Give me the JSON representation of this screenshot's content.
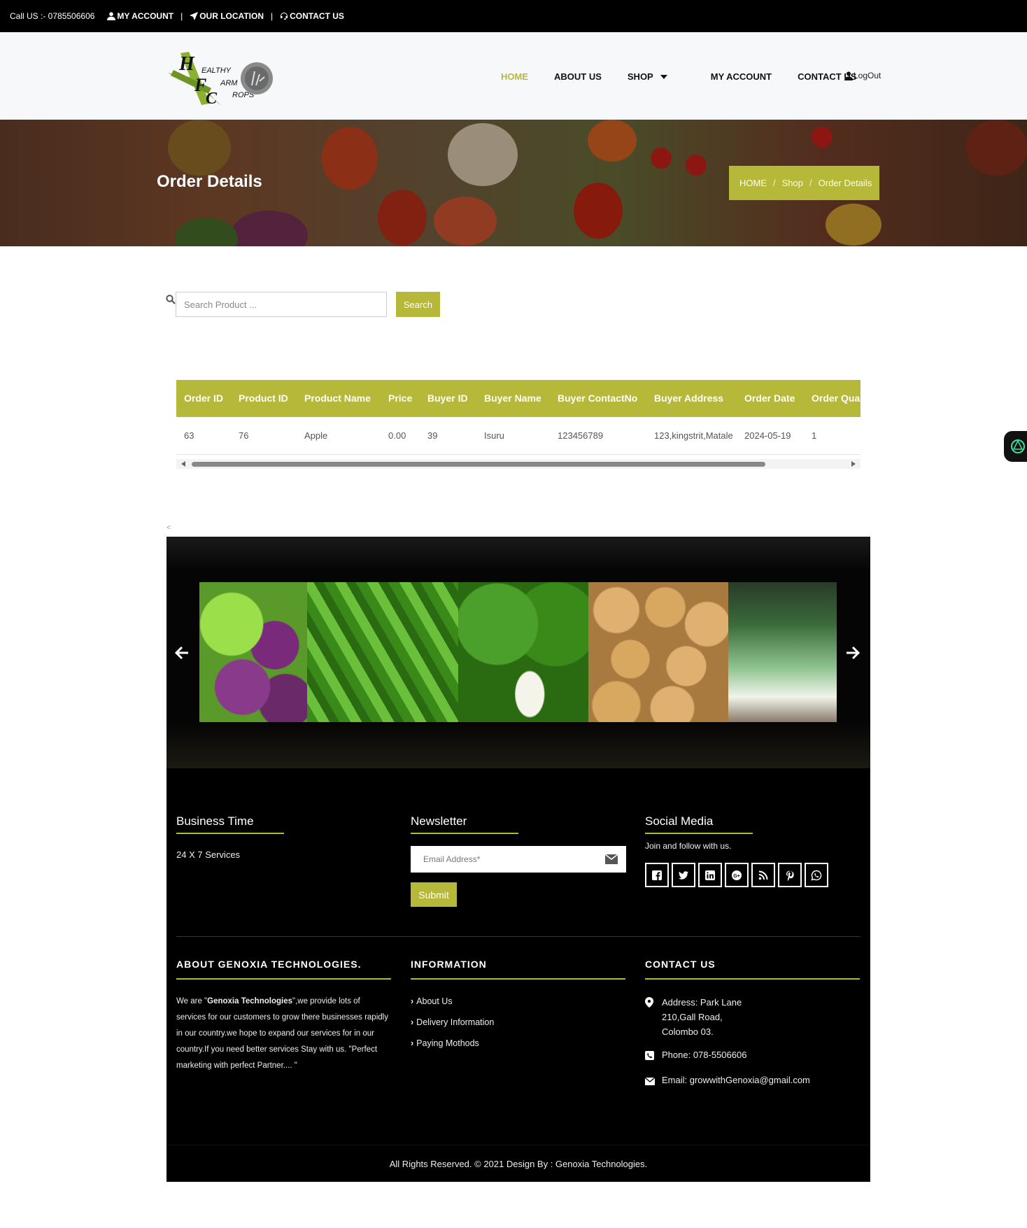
{
  "topbar": {
    "call_us": "Call US :- 0785506606",
    "my_account": "MY ACCOUNT",
    "our_location": "OUR LOCATION",
    "contact_us": "CONTACT US"
  },
  "logo": {
    "line1": "EALTHY",
    "line2": "ARM",
    "line3": "ROPS"
  },
  "nav": {
    "items": [
      {
        "label": "HOME",
        "active": true
      },
      {
        "label": "ABOUT US"
      },
      {
        "label": "SHOP"
      },
      {
        "label": "MY ACCOUNT"
      },
      {
        "label": "CONTACT US"
      }
    ],
    "logout": "LogOut"
  },
  "banner": {
    "title": "Order Details",
    "breadcrumb": [
      "HOME",
      "Shop",
      "Order Details"
    ]
  },
  "search": {
    "placeholder": "Search Product ...",
    "button": "Search"
  },
  "table": {
    "headers": [
      "Order ID",
      "Product ID",
      "Product Name",
      "Price",
      "Buyer ID",
      "Buyer Name",
      "Buyer ContactNo",
      "Buyer Address",
      "Order Date",
      "Order Qua"
    ],
    "rows": [
      [
        "63",
        "76",
        "Apple",
        "0.00",
        "39",
        "Isuru",
        "123456789",
        "123,kingstrit,Matale",
        "2024-05-19",
        "1"
      ]
    ]
  },
  "misc": {
    "lt_mark": "<"
  },
  "footer": {
    "business_title": "Business Time",
    "business_text": "24 X 7 Services",
    "newsletter_title": "Newsletter",
    "email_placeholder": "Email Address*",
    "submit": "Submit",
    "social_title": "Social Media",
    "social_text": "Join and follow with us.",
    "social_icons": [
      "facebook-icon",
      "twitter-icon",
      "linkedin-icon",
      "google-plus-icon",
      "rss-icon",
      "pinterest-icon",
      "whatsapp-icon"
    ],
    "about_title": "ABOUT GENOXIA TECHNOLOGIES.",
    "about_pre": "We are \"",
    "about_company": "Genoxia Technologies",
    "about_post": "\",we provide lots of services for our customers to grow there businesses rapidly in our country.we hope to expand our services for in our country.If you need better services Stay with us. \"Perfect marketing with perfect Partner.... \"",
    "info_title": "INFORMATION",
    "info_links": [
      "About Us",
      "Delivery Information",
      "Paying Mothods"
    ],
    "contact_title": "CONTACT US",
    "address_lines": [
      "Address: Park Lane",
      "210,Gall Road,",
      "Colombo 03."
    ],
    "phone": "Phone: 078-5506606",
    "email": "Email: growwithGenoxia@gmail.com",
    "copyright": "All Rights Reserved. © 2021 Design By : Genoxia Technologies."
  },
  "colors": {
    "accent": "#b6b83a",
    "dark": "#000000"
  }
}
